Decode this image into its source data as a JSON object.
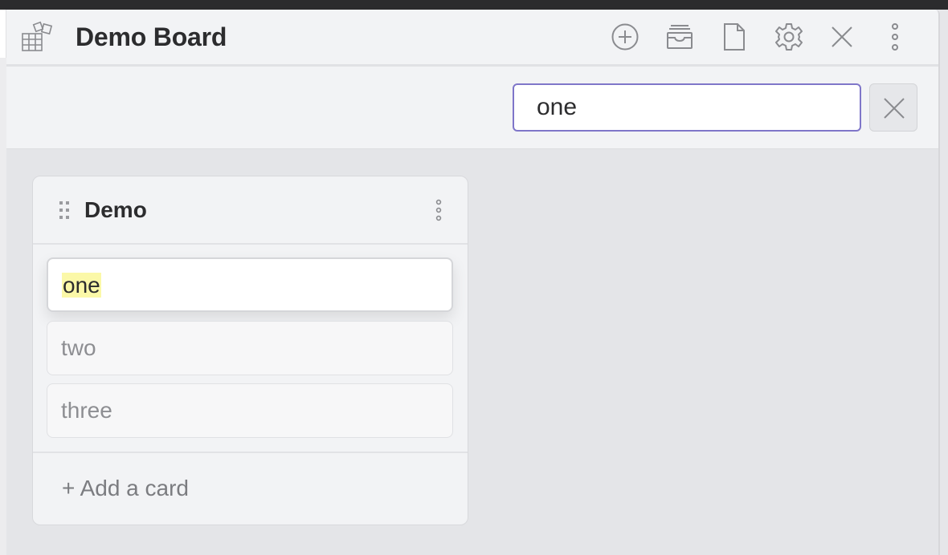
{
  "board": {
    "title": "Demo Board"
  },
  "header_actions": [
    {
      "icon": "plus-circle-icon"
    },
    {
      "icon": "archive-icon"
    },
    {
      "icon": "document-icon"
    },
    {
      "icon": "gear-icon"
    },
    {
      "icon": "close-icon"
    },
    {
      "icon": "more-vertical-icon"
    }
  ],
  "search": {
    "value": "one",
    "placeholder": ""
  },
  "lane": {
    "title": "Demo",
    "cards": [
      {
        "text": "one",
        "highlighted": true
      },
      {
        "text": "two",
        "highlighted": false
      },
      {
        "text": "three",
        "highlighted": false
      }
    ],
    "add_card_label": "+ Add a card"
  },
  "colors": {
    "accent": "#7f76c9",
    "highlight": "#fbf8a8"
  }
}
